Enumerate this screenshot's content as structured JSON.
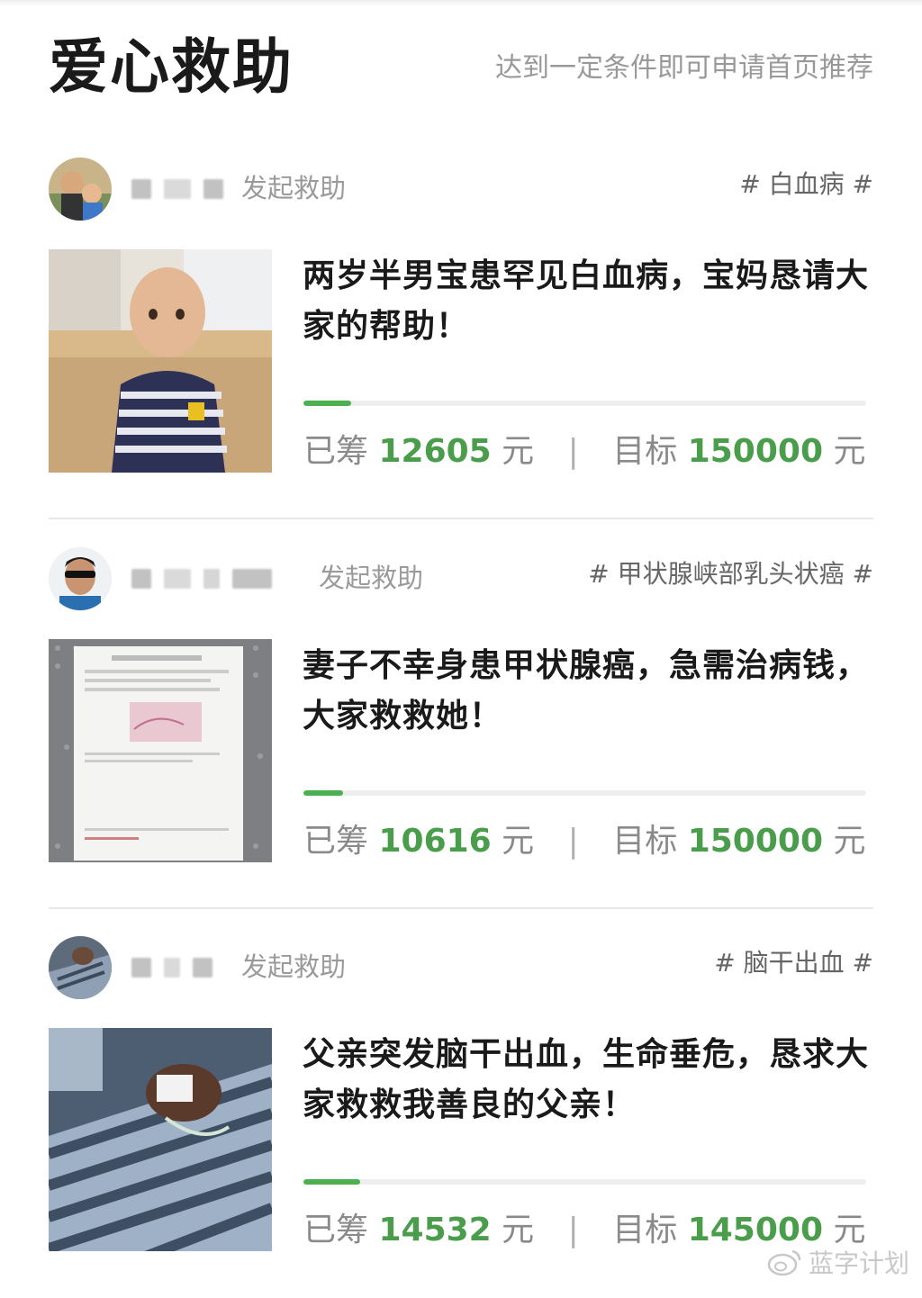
{
  "header": {
    "title": "爱心救助",
    "subtitle": "达到一定条件即可申请首页推荐"
  },
  "cards": [
    {
      "action": "发起救助",
      "tag": "# 白血病 #",
      "title": "两岁半男宝患罕见白血病，宝妈恳请大家的帮助！",
      "raised_label": "已筹",
      "raised": "12605",
      "raised_unit": "元",
      "sep": "|",
      "goal_label": "目标",
      "goal": "150000",
      "goal_unit": "元",
      "progress": 0.084
    },
    {
      "action": "发起救助",
      "tag": "# 甲状腺峡部乳头状癌 #",
      "title": "妻子不幸身患甲状腺癌，急需治病钱，大家救救她！",
      "raised_label": "已筹",
      "raised": "10616",
      "raised_unit": "元",
      "sep": "|",
      "goal_label": "目标",
      "goal": "150000",
      "goal_unit": "元",
      "progress": 0.071
    },
    {
      "action": "发起救助",
      "tag": "# 脑干出血 #",
      "title": "父亲突发脑干出血，生命垂危，恳求大家救救我善良的父亲！",
      "raised_label": "已筹",
      "raised": "14532",
      "raised_unit": "元",
      "sep": "|",
      "goal_label": "目标",
      "goal": "145000",
      "goal_unit": "元",
      "progress": 0.1
    }
  ],
  "watermark": {
    "text": "蓝字计划",
    "icon": "weibo-icon"
  },
  "colors": {
    "accent": "#4caf50",
    "number": "#4a9d4a",
    "muted": "#999999"
  }
}
